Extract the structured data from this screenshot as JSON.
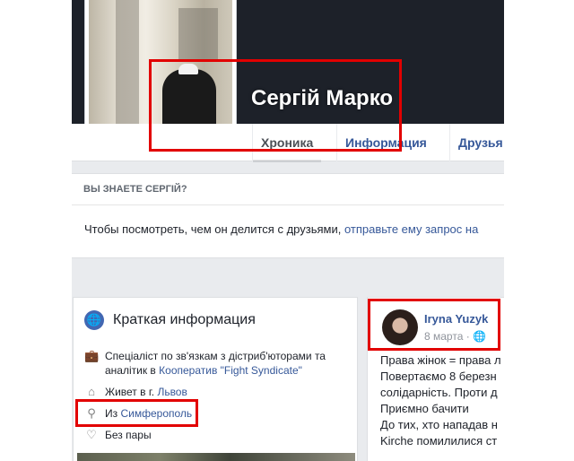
{
  "profile": {
    "name": "Сергій Марко"
  },
  "tabs": [
    {
      "label": "Хроника"
    },
    {
      "label": "Информация"
    },
    {
      "label": "Друзья"
    }
  ],
  "friend_prompt": {
    "heading": "ВЫ ЗНАЕТЕ СЕРГІЙ?",
    "text": "Чтобы посмотреть, чем он делится с друзьями,",
    "link": "отправьте ему запрос на"
  },
  "intro": {
    "title": "Краткая информация",
    "work_text": "Спеціаліст по зв'язкам з дістриб'юторами та аналітик в",
    "work_link": "Кооператив \"Fight Syndicate\"",
    "lives_text": "Живет в г.",
    "lives_link": "Львов",
    "from_text": "Из",
    "from_link": "Симферополь",
    "relationship": "Без пары"
  },
  "post": {
    "author": "Iryna Yuzyk",
    "date": "8 марта · ",
    "lines": [
      "Права жінок = права л",
      "Повертаємо 8 березн",
      "солідарність. Проти д",
      "Приємно бачити",
      "До тих, хто нападав н",
      "Kirche помилилися ст"
    ]
  },
  "icons": {
    "globe": "globe-icon",
    "work": "briefcase-icon",
    "home": "home-icon",
    "location": "location-pin-icon",
    "heart": "heart-icon",
    "audience": "public-globe-icon"
  },
  "colors": {
    "link": "#365899",
    "highlight": "#e20000",
    "cover": "#1d2129"
  }
}
